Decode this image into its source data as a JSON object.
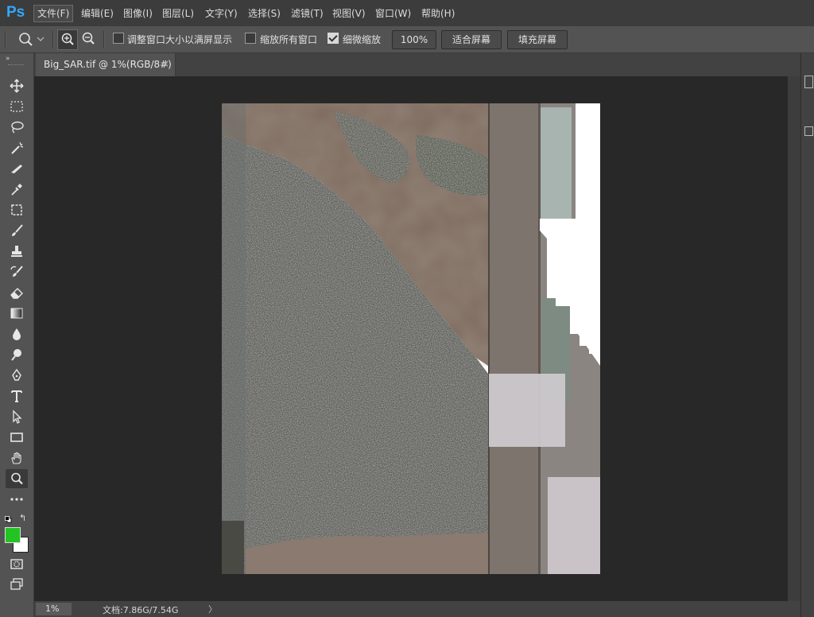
{
  "app": {
    "logo": "Ps"
  },
  "menu": [
    "文件(F)",
    "编辑(E)",
    "图像(I)",
    "图层(L)",
    "文字(Y)",
    "选择(S)",
    "滤镜(T)",
    "视图(V)",
    "窗口(W)",
    "帮助(H)"
  ],
  "options": {
    "resize_windows_label": "调整窗口大小以满屏显示",
    "zoom_all_windows_label": "缩放所有窗口",
    "scrubby_zoom_label": "细微缩放",
    "zoom_percent": "100%",
    "fit_screen_label": "适合屏幕",
    "fill_screen_label": "填充屏幕",
    "resize_windows_checked": false,
    "zoom_all_windows_checked": false,
    "scrubby_zoom_checked": true
  },
  "document": {
    "tab_title": "Big_SAR.tif @ 1%(RGB/8#)",
    "close_glyph": "×"
  },
  "status": {
    "zoom": "1%",
    "doc_info": "文档:7.86G/7.54G",
    "arrow": "〉"
  },
  "colors": {
    "foreground": "#22c322",
    "background": "#ffffff",
    "accent": "#31a8ff"
  }
}
